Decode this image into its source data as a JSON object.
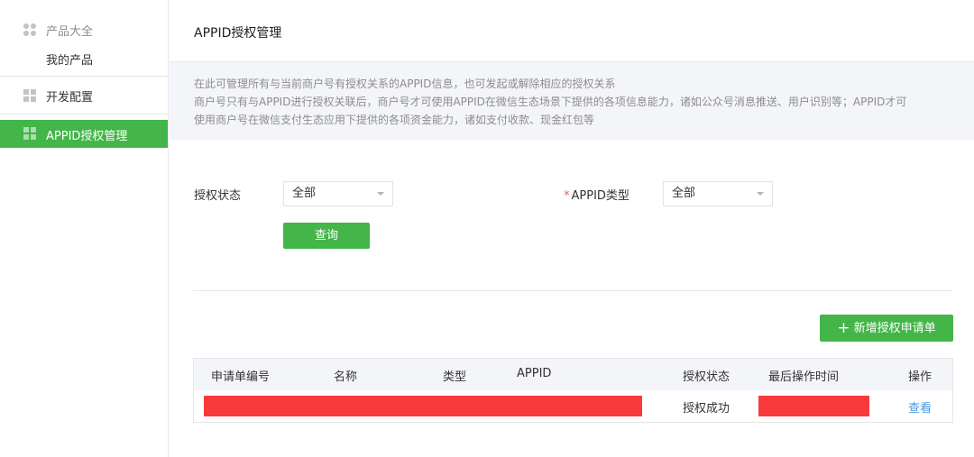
{
  "sidebar": {
    "products_group": "产品大全",
    "my_products": "我的产品",
    "dev_config": "开发配置",
    "appid_auth": "APPID授权管理"
  },
  "page": {
    "title": "APPID授权管理",
    "notice": [
      "在此可管理所有与当前商户号有授权关系的APPID信息，也可发起或解除相应的授权关系",
      "商户号只有与APPID进行授权关联后，商户号才可使用APPID在微信生态场景下提供的各项信息能力，诸如公众号消息推送、用户识别等；APPID才可",
      "使用商户号在微信支付生态应用下提供的各项资金能力，诸如支付收款、现金红包等"
    ]
  },
  "filters": {
    "status_label": "授权状态",
    "status_value": "全部",
    "type_required_mark": "*",
    "type_label": "APPID类型",
    "type_value": "全部",
    "query_button": "查询"
  },
  "actions": {
    "add_icon": "+",
    "add_button": "新增授权申请单"
  },
  "table": {
    "columns": [
      "申请单编号",
      "名称",
      "类型",
      "APPID",
      "授权状态",
      "最后操作时间",
      "操作"
    ],
    "rows": [
      {
        "status": "授权成功",
        "action": "查看"
      }
    ]
  },
  "colors": {
    "accent": "#44b549",
    "link": "#459ae9",
    "redaction": "#f93a3a"
  }
}
